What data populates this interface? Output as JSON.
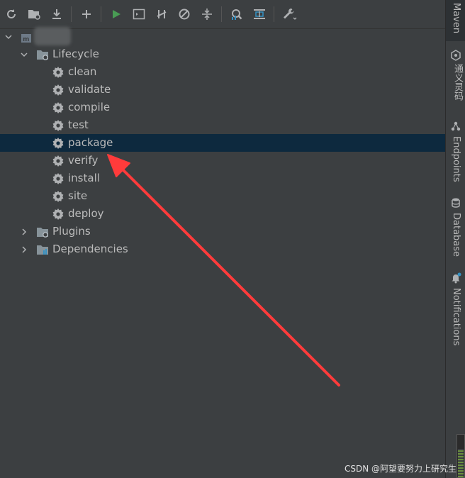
{
  "toolbar": {
    "buttons": [
      {
        "icon": "refresh-icon"
      },
      {
        "icon": "add-folder-icon"
      },
      {
        "icon": "download-icon"
      },
      {
        "icon": "plus-icon"
      },
      {
        "icon": "run-icon"
      },
      {
        "icon": "run-config-icon"
      },
      {
        "icon": "toggle-offline-icon"
      },
      {
        "icon": "skip-tests-icon"
      },
      {
        "icon": "collapse-all-icon"
      },
      {
        "icon": "analyze-dependencies-icon"
      },
      {
        "icon": "show-dependencies-icon"
      },
      {
        "icon": "settings-wrench-icon"
      }
    ]
  },
  "tree": {
    "project_label": "",
    "lifecycle": {
      "label": "Lifecycle",
      "goals": [
        "clean",
        "validate",
        "compile",
        "test",
        "package",
        "verify",
        "install",
        "site",
        "deploy"
      ],
      "selected": "package"
    },
    "plugins_label": "Plugins",
    "dependencies_label": "Dependencies"
  },
  "right_tabs": {
    "maven": "Maven",
    "ai": "通义灵码",
    "endpoints": "Endpoints",
    "database": "Database",
    "notifications": "Notifications"
  },
  "watermark": "CSDN @阿望要努力上研究生",
  "colors": {
    "selection": "#0d293e",
    "arrow": "#ff3b3b",
    "run": "#499c54"
  }
}
